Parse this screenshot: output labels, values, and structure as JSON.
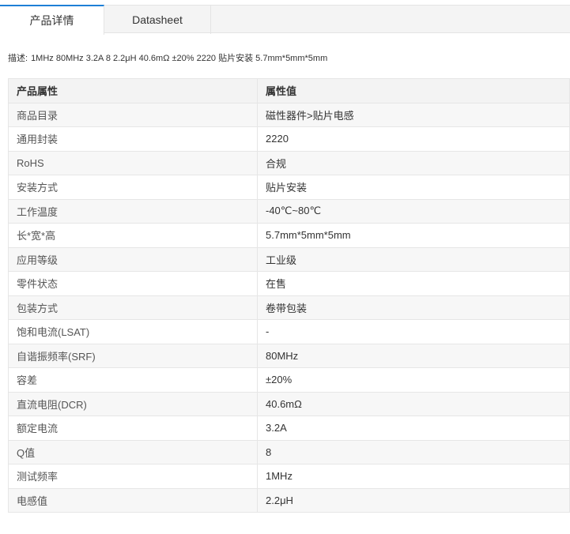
{
  "tabs": [
    {
      "label": "产品详情",
      "active": true
    },
    {
      "label": "Datasheet",
      "active": false
    }
  ],
  "description": {
    "label": "描述:",
    "text": "1MHz 80MHz 3.2A 8 2.2μH 40.6mΩ ±20% 2220 贴片安装 5.7mm*5mm*5mm"
  },
  "table": {
    "headers": [
      "产品属性",
      "属性值"
    ],
    "rows": [
      [
        "商品目录",
        "磁性器件>贴片电感"
      ],
      [
        "通用封装",
        "2220"
      ],
      [
        "RoHS",
        "合规"
      ],
      [
        "安装方式",
        "贴片安装"
      ],
      [
        "工作温度",
        "-40℃~80℃"
      ],
      [
        "长*宽*高",
        "5.7mm*5mm*5mm"
      ],
      [
        "应用等级",
        "工业级"
      ],
      [
        "零件状态",
        "在售"
      ],
      [
        "包装方式",
        "卷带包装"
      ],
      [
        "饱和电流(LSAT)",
        "-"
      ],
      [
        "自谐振频率(SRF)",
        "80MHz"
      ],
      [
        "容差",
        "±20%"
      ],
      [
        "直流电阻(DCR)",
        "40.6mΩ"
      ],
      [
        "额定电流",
        "3.2A"
      ],
      [
        "Q值",
        "8"
      ],
      [
        "测试频率",
        "1MHz"
      ],
      [
        "电感值",
        "2.2μH"
      ]
    ]
  },
  "colors": {
    "accent": "#1e7fd6",
    "header_bg": "#f3f3f3",
    "row_alt_bg": "#f7f7f7",
    "border": "#e6e6e6"
  }
}
